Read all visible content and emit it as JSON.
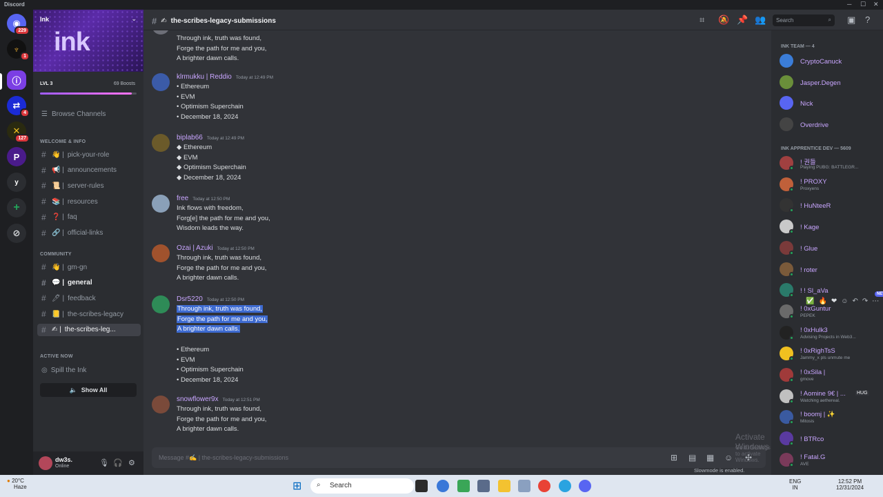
{
  "window": {
    "title": "Discord"
  },
  "rail": {
    "badges": [
      "229",
      "1",
      "4",
      "127"
    ]
  },
  "server": {
    "name": "Ink",
    "logo_text": "ink",
    "level": "LVL 3",
    "boosts": "69 Boosts",
    "level_progress": 0.95
  },
  "sidebar": {
    "browse": "Browse Channels",
    "cat_welcome": "WELCOME & INFO",
    "welcome_channels": [
      "pick-your-role",
      "announcements",
      "server-rules",
      "resources",
      "faq",
      "official-links"
    ],
    "cat_community": "COMMUNITY",
    "community_channels": [
      "gm-gn",
      "general",
      "feedback",
      "the-scribes-legacy",
      "the-scribes-leg..."
    ],
    "active_now": "ACTIVE NOW",
    "spill": "Spill the Ink",
    "show_all": "Show All"
  },
  "user": {
    "name": "dw3s.",
    "status": "Online"
  },
  "header": {
    "channel": "the-scribes-legacy-submissions",
    "search_placeholder": "Search"
  },
  "messages": [
    {
      "author": "",
      "time": "",
      "lines": [
        "Through ink, truth was found,",
        "Forge the path for me and you,",
        "A brighter dawn calls."
      ]
    },
    {
      "author": "klrmukku | Reddio",
      "time": "Today at 12:49 PM",
      "lines": [
        "• Ethereum",
        "• EVM",
        "• Optimism Superchain",
        "• December 18, 2024"
      ]
    },
    {
      "author": "biplab66",
      "time": "Today at 12:49 PM",
      "lines": [
        "◆ Ethereum",
        "◆ EVM",
        "◆ Optimism Superchain",
        "◆ December 18, 2024"
      ]
    },
    {
      "author": "free",
      "time": "Today at 12:50 PM",
      "lines": [
        "Ink flows with freedom,",
        "Forg[e] the path for me and you,",
        "Wisdom leads the way."
      ]
    },
    {
      "author": "Ozai | Azuki",
      "time": "Today at 12:50 PM",
      "lines": [
        "Through ink, truth was found,",
        "Forge the path for me and you,",
        "A brighter dawn calls."
      ]
    },
    {
      "author": "Dsr5220",
      "time": "Today at 12:50 PM",
      "lines": [
        "Through ink, truth was found,",
        "Forge the path for me and you,",
        "A brighter dawn calls.",
        "",
        "• Ethereum",
        "• EVM",
        "• Optimism Superchain",
        "• December 18, 2024"
      ]
    },
    {
      "author": "snowflower9x",
      "time": "Today at 12:51 PM",
      "lines": [
        "Through ink, truth was found,",
        "Forge the path for me and you,",
        "A brighter dawn calls."
      ]
    }
  ],
  "new_tag": "NEW",
  "composer": {
    "placeholder": "Message #✍️ | the-scribes-legacy-submissions",
    "slowmode": "Slowmode is enabled."
  },
  "watermark": {
    "title": "Activate Windows",
    "sub": "Go to Settings to activate Windows."
  },
  "members": {
    "team_title": "INK TEAM — 4",
    "team": [
      {
        "name": "CryptoCanuck",
        "status": ""
      },
      {
        "name": "Jasper.Degen",
        "status": ""
      },
      {
        "name": "Nick",
        "status": ""
      },
      {
        "name": "Overdrive",
        "status": ""
      }
    ],
    "dev_title": "INK APPRENTICE DEV — 5609",
    "dev": [
      {
        "name": "! 권들",
        "status": "Playing PUBG: BATTLEGR..."
      },
      {
        "name": "! PROXY",
        "status": "Proxyens"
      },
      {
        "name": "! HuNteeR",
        "status": ""
      },
      {
        "name": "! Kage",
        "status": ""
      },
      {
        "name": "! Glue",
        "status": ""
      },
      {
        "name": "! roter",
        "status": ""
      },
      {
        "name": "! ! Sl_aVa",
        "status": ""
      },
      {
        "name": "! 0xGuntur",
        "status": "PEPEK"
      },
      {
        "name": "! 0xHulk3",
        "status": "Advising Projects in Web3..."
      },
      {
        "name": "! 0xRighTsS",
        "status": "Jammy_x pls unmute me"
      },
      {
        "name": "! 0xSila |",
        "status": "gmove"
      },
      {
        "name": "! Aomine 9€ | ...",
        "status": "Watching aethereal."
      },
      {
        "name": "! boomj | ✨",
        "status": "Mitosis"
      },
      {
        "name": "! BTRco",
        "status": ""
      },
      {
        "name": "! Fatal.G",
        "status": "AVE"
      }
    ],
    "hug": "HUG"
  },
  "taskbar": {
    "weather": "20°C",
    "weather_sub": "Haze",
    "search": "Search",
    "lang": "ENG",
    "lang_sub": "IN",
    "time": "12:52 PM",
    "date": "12/31/2024"
  }
}
